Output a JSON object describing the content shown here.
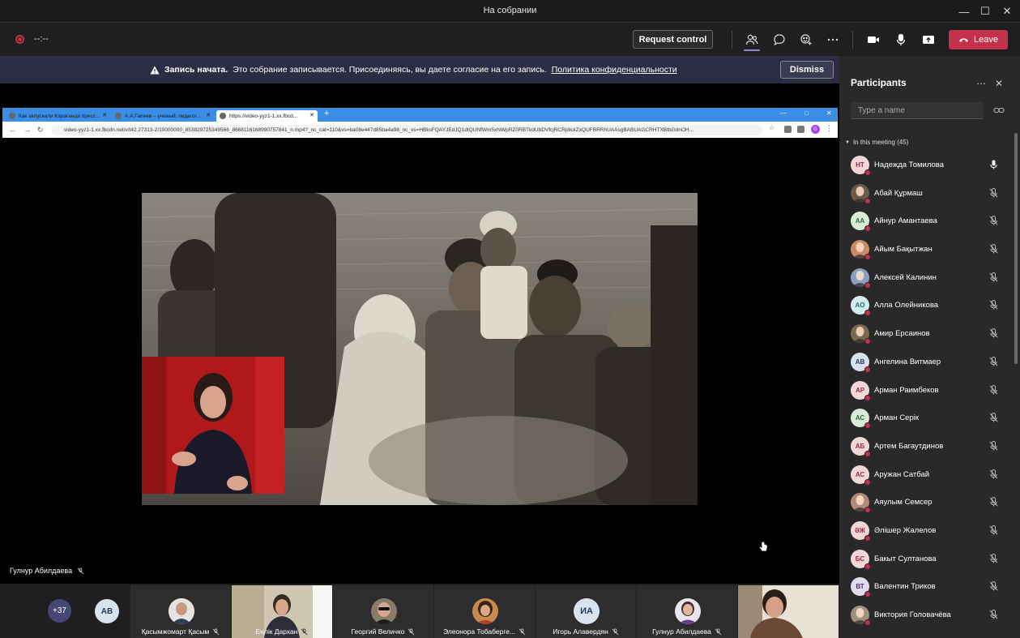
{
  "window": {
    "title": "На собрании"
  },
  "toolbar": {
    "timer": "--:--",
    "request_control": "Request control",
    "leave": "Leave"
  },
  "banner": {
    "bold": "Запись начата.",
    "text": "Это собрание записывается. Присоединяясь, вы даете согласие на его запись.",
    "link": "Политика конфиденциальности",
    "dismiss": "Dismiss"
  },
  "browser": {
    "tabs": [
      {
        "label": "Как запускали Караганда пресс..."
      },
      {
        "label": "А.А.Гапеев – ученый, педагог..."
      },
      {
        "label": "https://video-yyz1-1.xx.fbcd..."
      }
    ],
    "url": "video-yyz1-1.xx.fbcdn.net/v/t42.27313-2/10000000_853829725349566_8668116168990757841_n.mp4?_nc_cat=110&vs=ba08e447d85ba4a98_nc_vs=HBksFQAYJEdJQ1dtQUNfWm5xNWpRZ0RBTkdUbDVfcjRCRjdickZxQUFBRRhUAAsgBABUAGCRHTXBtbGdnOH...",
    "profile_initial": "G"
  },
  "presenter": {
    "name": "Гулнур Абилдаева"
  },
  "strip": {
    "more_count": "+37",
    "av_initials": "AB",
    "tiles": [
      {
        "name": "Қасымжомарт Қасым",
        "type": "photo"
      },
      {
        "name": "Еңлік Дархан",
        "type": "video"
      },
      {
        "name": "Георгий Величко",
        "type": "photo"
      },
      {
        "name": "Элеонора Тобаберге...",
        "type": "photo"
      },
      {
        "name": "Игорь Алавердян",
        "type": "initials",
        "initials": "ИА"
      },
      {
        "name": "Гулнур Абилдаева",
        "type": "photo"
      }
    ]
  },
  "panel": {
    "title": "Participants",
    "search_placeholder": "Type a name",
    "section": "In this meeting (45)",
    "participants": [
      {
        "name": "Надежда Томилова",
        "initials": "НТ",
        "bg": "#f3d6d8",
        "fg": "#8f2e3a",
        "mic": "on"
      },
      {
        "name": "Абай Құрмаш",
        "initials": "",
        "bg": "#6b5a4a",
        "fg": "#fff",
        "mic": "off"
      },
      {
        "name": "Айнур Амантаева",
        "initials": "АА",
        "bg": "#d8ecd8",
        "fg": "#2e6b3a",
        "mic": "off"
      },
      {
        "name": "Айым Бақытжан",
        "initials": "",
        "bg": "#c98a6a",
        "fg": "#fff",
        "mic": "off"
      },
      {
        "name": "Алексей Калинин",
        "initials": "",
        "bg": "#8aa0c0",
        "fg": "#fff",
        "mic": "off"
      },
      {
        "name": "Алла Олейникова",
        "initials": "АО",
        "bg": "#d4eef0",
        "fg": "#2a6b72",
        "mic": "off"
      },
      {
        "name": "Амир Ерсаинов",
        "initials": "",
        "bg": "#7a6a50",
        "fg": "#fff",
        "mic": "off"
      },
      {
        "name": "Ангелина Витмаер",
        "initials": "АВ",
        "bg": "#d9e3f0",
        "fg": "#243a5e",
        "mic": "off"
      },
      {
        "name": "Арман Раимбеков",
        "initials": "АР",
        "bg": "#f3d6d8",
        "fg": "#8f2e3a",
        "mic": "off"
      },
      {
        "name": "Арман Серік",
        "initials": "АС",
        "bg": "#d8ecd8",
        "fg": "#2e6b3a",
        "mic": "off"
      },
      {
        "name": "Артем Багаутдинов",
        "initials": "АБ",
        "bg": "#f3d6d8",
        "fg": "#8f2e3a",
        "mic": "off"
      },
      {
        "name": "Аружан Сатбай",
        "initials": "АС",
        "bg": "#f3d6d8",
        "fg": "#8f2e3a",
        "mic": "off"
      },
      {
        "name": "Аяулым Семсер",
        "initials": "",
        "bg": "#b08a7a",
        "fg": "#fff",
        "mic": "off"
      },
      {
        "name": "Әлішер Жалелов",
        "initials": "ӘЖ",
        "bg": "#f3d6d8",
        "fg": "#8f2e3a",
        "mic": "off"
      },
      {
        "name": "Бакыт Султанова",
        "initials": "БС",
        "bg": "#f3d6d8",
        "fg": "#8f2e3a",
        "mic": "off"
      },
      {
        "name": "Валентин Триков",
        "initials": "ВТ",
        "bg": "#e2dcf0",
        "fg": "#4b3a7a",
        "mic": "off"
      },
      {
        "name": "Виктория Головачёва",
        "initials": "",
        "bg": "#a09080",
        "fg": "#fff",
        "mic": "off"
      }
    ]
  },
  "colors": {
    "accent": "#8b8cc7",
    "leave": "#c4314b",
    "banner": "#2d2c45"
  }
}
